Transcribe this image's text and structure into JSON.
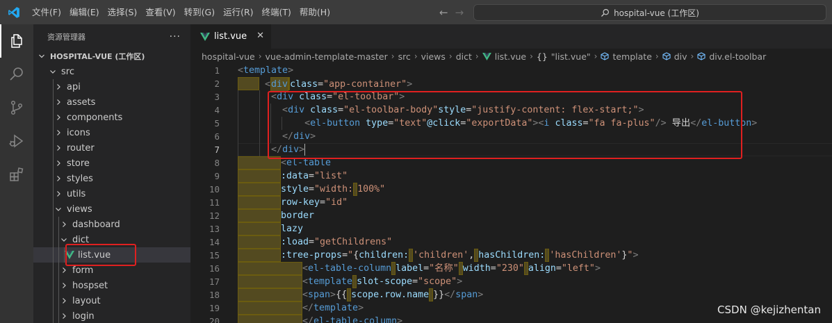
{
  "titlebar": {
    "menus": [
      "文件(F)",
      "编辑(E)",
      "选择(S)",
      "查看(V)",
      "转到(G)",
      "运行(R)",
      "终端(T)",
      "帮助(H)"
    ],
    "search_text": "hospital-vue (工作区)"
  },
  "sidebar": {
    "title": "资源管理器",
    "more": "···",
    "workspace": "HOSPITAL-VUE (工作区)",
    "items": [
      {
        "label": "src",
        "depth": 1,
        "expanded": true
      },
      {
        "label": "api",
        "depth": 2,
        "expanded": false
      },
      {
        "label": "assets",
        "depth": 2,
        "expanded": false
      },
      {
        "label": "components",
        "depth": 2,
        "expanded": false
      },
      {
        "label": "icons",
        "depth": 2,
        "expanded": false
      },
      {
        "label": "router",
        "depth": 2,
        "expanded": false
      },
      {
        "label": "store",
        "depth": 2,
        "expanded": false
      },
      {
        "label": "styles",
        "depth": 2,
        "expanded": false
      },
      {
        "label": "utils",
        "depth": 2,
        "expanded": false
      },
      {
        "label": "views",
        "depth": 2,
        "expanded": true
      },
      {
        "label": "dashboard",
        "depth": 3,
        "expanded": false
      },
      {
        "label": "dict",
        "depth": 3,
        "expanded": true
      },
      {
        "label": "list.vue",
        "depth": 4,
        "file": true,
        "selected": true
      },
      {
        "label": "form",
        "depth": 3,
        "expanded": false
      },
      {
        "label": "hospset",
        "depth": 3,
        "expanded": false
      },
      {
        "label": "layout",
        "depth": 3,
        "expanded": false
      },
      {
        "label": "login",
        "depth": 3,
        "expanded": false
      }
    ]
  },
  "editor": {
    "tab_label": "list.vue",
    "breadcrumbs": [
      "hospital-vue",
      "vue-admin-template-master",
      "src",
      "views",
      "dict",
      "list.vue",
      "\"list.vue\"",
      "template",
      "div",
      "div.el-toolbar"
    ],
    "line_numbers": [
      "1",
      "2",
      "3",
      "4",
      "5",
      "6",
      "7",
      "8",
      "9",
      "10",
      "11",
      "12",
      "13",
      "14",
      "15",
      "16",
      "17",
      "18",
      "19",
      "20"
    ],
    "current_line": "7"
  },
  "watermark": "CSDN @kejizhentan",
  "colors": {
    "highlight_box": "#e02020",
    "vue_icon": "#41b883",
    "tag": "#569cd6",
    "attribute": "#9cdcfe",
    "string": "#ce9178"
  }
}
